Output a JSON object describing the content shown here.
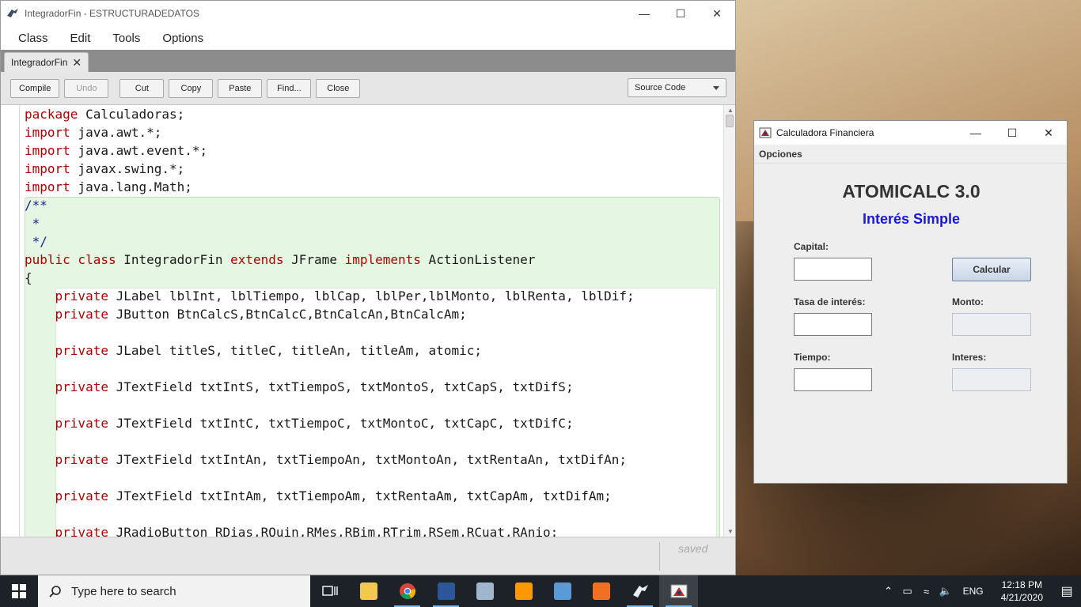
{
  "editor": {
    "title": "IntegradorFin - ESTRUCTURADEDATOS",
    "menu": [
      "Class",
      "Edit",
      "Tools",
      "Options"
    ],
    "tab_label": "IntegradorFin",
    "toolbar": {
      "compile": "Compile",
      "undo": "Undo",
      "cut": "Cut",
      "copy": "Copy",
      "paste": "Paste",
      "find": "Find...",
      "close": "Close",
      "view_select": "Source Code"
    },
    "status": "saved",
    "code_lines": [
      {
        "kw": "package",
        "rest": " Calculadoras;"
      },
      {
        "kw": "import",
        "rest": " java.awt.*;"
      },
      {
        "kw": "import",
        "rest": " java.awt.event.*;"
      },
      {
        "kw": "import",
        "rest": " javax.swing.*;"
      },
      {
        "kw": "import",
        "rest": " java.lang.Math;"
      },
      {
        "cm": "/**"
      },
      {
        "cm": " *"
      },
      {
        "cm": " */"
      },
      {
        "kw": "public",
        "kw2": " class",
        "rest": " IntegradorFin",
        "kw3": " extends",
        "rest2": " JFrame",
        "kw4": " implements",
        "rest3": " ActionListener"
      },
      {
        "rest": "{"
      },
      {
        "indent": "    ",
        "kw": "private",
        "rest": " JLabel lblInt, lblTiempo, lblCap, lblPer,lblMonto, lblRenta, lblDif;"
      },
      {
        "indent": "    ",
        "kw": "private",
        "rest": " JButton BtnCalcS,BtnCalcC,BtnCalcAn,BtnCalcAm;"
      },
      {
        "rest": ""
      },
      {
        "indent": "    ",
        "kw": "private",
        "rest": " JLabel titleS, titleC, titleAn, titleAm, atomic;"
      },
      {
        "rest": ""
      },
      {
        "indent": "    ",
        "kw": "private",
        "rest": " JTextField txtIntS, txtTiempoS, txtMontoS, txtCapS, txtDifS;"
      },
      {
        "rest": ""
      },
      {
        "indent": "    ",
        "kw": "private",
        "rest": " JTextField txtIntC, txtTiempoC, txtMontoC, txtCapC, txtDifC;"
      },
      {
        "rest": ""
      },
      {
        "indent": "    ",
        "kw": "private",
        "rest": " JTextField txtIntAn, txtTiempoAn, txtMontoAn, txtRentaAn, txtDifAn;"
      },
      {
        "rest": ""
      },
      {
        "indent": "    ",
        "kw": "private",
        "rest": " JTextField txtIntAm, txtTiempoAm, txtRentaAm, txtCapAm, txtDifAm;"
      },
      {
        "rest": ""
      },
      {
        "indent": "    ",
        "kw": "private",
        "rest": " JRadioButton RDias,RQuin,RMes,RBim,RTrim,RSem,RCuat,RAnio;"
      }
    ]
  },
  "calculator": {
    "title": "Calculadora Financiera",
    "menu": "Opciones",
    "heading": "ATOMICALC 3.0",
    "subheading": "Interés Simple",
    "labels": {
      "capital": "Capital:",
      "tasa": "Tasa de interés:",
      "tiempo": "Tiempo:",
      "monto": "Monto:",
      "interes": "Interes:"
    },
    "button": "Calcular",
    "colors": {
      "subheading": "#1a1ad0"
    }
  },
  "taskbar": {
    "search_placeholder": "Type here to search",
    "language": "ENG",
    "time": "12:18 PM",
    "date": "4/21/2020"
  }
}
